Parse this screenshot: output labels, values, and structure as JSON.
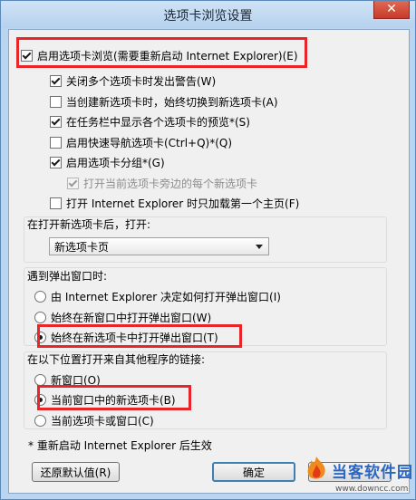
{
  "window": {
    "title": "选项卡浏览设置",
    "close_glyph": "✕"
  },
  "options": {
    "enable_tabs": {
      "label": "启用选项卡浏览(需要重新启动 Internet Explorer)(E)",
      "checked": true
    },
    "items": [
      {
        "label": "关闭多个选项卡时发出警告(W)",
        "checked": true
      },
      {
        "label": "当创建新选项卡时，始终切换到新选项卡(A)",
        "checked": false
      },
      {
        "label": "在任务栏中显示各个选项卡的预览*(S)",
        "checked": true
      },
      {
        "label": "启用快速导航选项卡(Ctrl+Q)*(Q)",
        "checked": false
      },
      {
        "label": "启用选项卡分组*(G)",
        "checked": true
      },
      {
        "label": "打开当前选项卡旁边的每个新选项卡",
        "checked": true,
        "disabled": true
      },
      {
        "label": "打开 Internet Explorer 时只加载第一个主页(F)",
        "checked": false
      }
    ]
  },
  "new_tab": {
    "group_label": "在打开新选项卡后，打开:",
    "selected": "新选项卡页"
  },
  "popups": {
    "group_label": "遇到弹出窗口时:",
    "options": [
      {
        "label": "由 Internet Explorer 决定如何打开弹出窗口(I)",
        "selected": false
      },
      {
        "label": "始终在新窗口中打开弹出窗口(W)",
        "selected": false
      },
      {
        "label": "始终在新选项卡中打开弹出窗口(T)",
        "selected": true
      }
    ]
  },
  "links": {
    "group_label": "在以下位置打开来自其他程序的链接:",
    "options": [
      {
        "label": "新窗口(O)",
        "selected": false
      },
      {
        "label": "当前窗口中的新选项卡(B)",
        "selected": true
      },
      {
        "label": "当前选项卡或窗口(C)",
        "selected": false
      }
    ]
  },
  "footnote": "* 重新启动 Internet Explorer 后生效",
  "buttons": {
    "restore_defaults": "还原默认值(R)",
    "ok": "确定"
  },
  "watermark": {
    "title": "当客软件园",
    "url": "www.downcc.com"
  },
  "colors": {
    "highlight": "#e8262a",
    "default_button_border": "#3c7fb1"
  }
}
